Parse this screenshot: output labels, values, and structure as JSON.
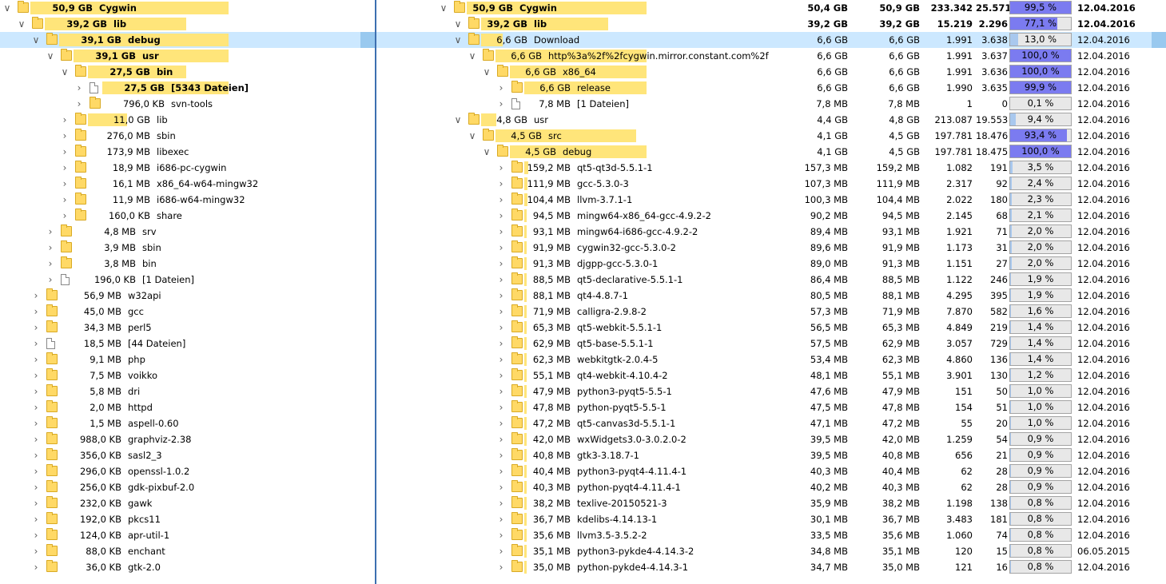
{
  "colors": {
    "bar_primary": "#ffe57a",
    "bar_secondary": "#fff0b4",
    "selection": "#cce8ff",
    "pct_fill_high": "#7b7bf0",
    "pct_fill_low": "#a9c8ee",
    "pct_bg": "#e8e8e8",
    "splitter": "#3d6fb0"
  },
  "left_tree": [
    {
      "depth": 0,
      "expander": "expanded",
      "icon": "folder",
      "size": "50,9 GB",
      "name": "Cygwin",
      "bold": true,
      "fraction": 1.0
    },
    {
      "depth": 1,
      "expander": "expanded",
      "icon": "folder",
      "size": "39,2 GB",
      "name": "lib",
      "bold": true,
      "fraction": 0.77
    },
    {
      "depth": 2,
      "expander": "expanded",
      "icon": "folder",
      "size": "39,1 GB",
      "name": "debug",
      "bold": true,
      "fraction": 1.0,
      "selected": true
    },
    {
      "depth": 3,
      "expander": "expanded",
      "icon": "folder",
      "size": "39,1 GB",
      "name": "usr",
      "bold": true,
      "fraction": 1.0
    },
    {
      "depth": 4,
      "expander": "expanded",
      "icon": "folder",
      "size": "27,5 GB",
      "name": "bin",
      "bold": true,
      "fraction": 0.7
    },
    {
      "depth": 5,
      "expander": "collapsed",
      "icon": "file",
      "size": "27,5 GB",
      "name": "[5343 Dateien]",
      "bold": true,
      "fraction": 1.0
    },
    {
      "depth": 5,
      "expander": "collapsed",
      "icon": "folder",
      "size": "796,0 KB",
      "name": "svn-tools",
      "bold": false,
      "fraction": 0.0
    },
    {
      "depth": 4,
      "expander": "collapsed",
      "icon": "folder",
      "size": "11,0 GB",
      "name": "lib",
      "bold": false,
      "fraction": 0.28
    },
    {
      "depth": 4,
      "expander": "collapsed",
      "icon": "folder",
      "size": "276,0 MB",
      "name": "sbin",
      "bold": false,
      "fraction": 0.0
    },
    {
      "depth": 4,
      "expander": "collapsed",
      "icon": "folder",
      "size": "173,9 MB",
      "name": "libexec",
      "bold": false,
      "fraction": 0.0
    },
    {
      "depth": 4,
      "expander": "collapsed",
      "icon": "folder",
      "size": "18,9 MB",
      "name": "i686-pc-cygwin",
      "bold": false,
      "fraction": 0.0
    },
    {
      "depth": 4,
      "expander": "collapsed",
      "icon": "folder",
      "size": "16,1 MB",
      "name": "x86_64-w64-mingw32",
      "bold": false,
      "fraction": 0.0
    },
    {
      "depth": 4,
      "expander": "collapsed",
      "icon": "folder",
      "size": "11,9 MB",
      "name": "i686-w64-mingw32",
      "bold": false,
      "fraction": 0.0
    },
    {
      "depth": 4,
      "expander": "collapsed",
      "icon": "folder",
      "size": "160,0 KB",
      "name": "share",
      "bold": false,
      "fraction": 0.0
    },
    {
      "depth": 3,
      "expander": "collapsed",
      "icon": "folder",
      "size": "4,8 MB",
      "name": "srv",
      "bold": false,
      "fraction": 0.0
    },
    {
      "depth": 3,
      "expander": "collapsed",
      "icon": "folder",
      "size": "3,9 MB",
      "name": "sbin",
      "bold": false,
      "fraction": 0.0
    },
    {
      "depth": 3,
      "expander": "collapsed",
      "icon": "folder",
      "size": "3,8 MB",
      "name": "bin",
      "bold": false,
      "fraction": 0.0
    },
    {
      "depth": 3,
      "expander": "collapsed",
      "icon": "file",
      "size": "196,0 KB",
      "name": "[1 Dateien]",
      "bold": false,
      "fraction": 0.0
    },
    {
      "depth": 2,
      "expander": "collapsed",
      "icon": "folder",
      "size": "56,9 MB",
      "name": "w32api",
      "bold": false,
      "fraction": 0.0
    },
    {
      "depth": 2,
      "expander": "collapsed",
      "icon": "folder",
      "size": "45,0 MB",
      "name": "gcc",
      "bold": false,
      "fraction": 0.0
    },
    {
      "depth": 2,
      "expander": "collapsed",
      "icon": "folder",
      "size": "34,3 MB",
      "name": "perl5",
      "bold": false,
      "fraction": 0.0
    },
    {
      "depth": 2,
      "expander": "collapsed",
      "icon": "file",
      "size": "18,5 MB",
      "name": "[44 Dateien]",
      "bold": false,
      "fraction": 0.0
    },
    {
      "depth": 2,
      "expander": "collapsed",
      "icon": "folder",
      "size": "9,1 MB",
      "name": "php",
      "bold": false,
      "fraction": 0.0
    },
    {
      "depth": 2,
      "expander": "collapsed",
      "icon": "folder",
      "size": "7,5 MB",
      "name": "voikko",
      "bold": false,
      "fraction": 0.0
    },
    {
      "depth": 2,
      "expander": "collapsed",
      "icon": "folder",
      "size": "5,8 MB",
      "name": "dri",
      "bold": false,
      "fraction": 0.0
    },
    {
      "depth": 2,
      "expander": "collapsed",
      "icon": "folder",
      "size": "2,0 MB",
      "name": "httpd",
      "bold": false,
      "fraction": 0.0
    },
    {
      "depth": 2,
      "expander": "collapsed",
      "icon": "folder",
      "size": "1,5 MB",
      "name": "aspell-0.60",
      "bold": false,
      "fraction": 0.0
    },
    {
      "depth": 2,
      "expander": "collapsed",
      "icon": "folder",
      "size": "988,0 KB",
      "name": "graphviz-2.38",
      "bold": false,
      "fraction": 0.0
    },
    {
      "depth": 2,
      "expander": "collapsed",
      "icon": "folder",
      "size": "356,0 KB",
      "name": "sasl2_3",
      "bold": false,
      "fraction": 0.0
    },
    {
      "depth": 2,
      "expander": "collapsed",
      "icon": "folder",
      "size": "296,0 KB",
      "name": "openssl-1.0.2",
      "bold": false,
      "fraction": 0.0
    },
    {
      "depth": 2,
      "expander": "collapsed",
      "icon": "folder",
      "size": "256,0 KB",
      "name": "gdk-pixbuf-2.0",
      "bold": false,
      "fraction": 0.0
    },
    {
      "depth": 2,
      "expander": "collapsed",
      "icon": "folder",
      "size": "232,0 KB",
      "name": "gawk",
      "bold": false,
      "fraction": 0.0
    },
    {
      "depth": 2,
      "expander": "collapsed",
      "icon": "folder",
      "size": "192,0 KB",
      "name": "pkcs11",
      "bold": false,
      "fraction": 0.0
    },
    {
      "depth": 2,
      "expander": "collapsed",
      "icon": "folder",
      "size": "124,0 KB",
      "name": "apr-util-1",
      "bold": false,
      "fraction": 0.0
    },
    {
      "depth": 2,
      "expander": "collapsed",
      "icon": "folder",
      "size": "88,0 KB",
      "name": "enchant",
      "bold": false,
      "fraction": 0.0
    },
    {
      "depth": 2,
      "expander": "collapsed",
      "icon": "folder",
      "size": "36,0 KB",
      "name": "gtk-2.0",
      "bold": false,
      "fraction": 0.0
    }
  ],
  "right_tree": [
    {
      "depth": 0,
      "expander": "expanded",
      "icon": "folder",
      "size": "50,9 GB",
      "name": "Cygwin",
      "bold": true,
      "fraction": 1.0,
      "alloc": "50,4 GB",
      "total": "50,9 GB",
      "files": "233.342",
      "folders": "25.571",
      "pct": "99,5 %",
      "pct_value": 99.5,
      "date": "12.04.2016"
    },
    {
      "depth": 1,
      "expander": "expanded",
      "icon": "folder",
      "size": "39,2 GB",
      "name": "lib",
      "bold": true,
      "fraction": 0.77,
      "alloc": "39,2 GB",
      "total": "39,2 GB",
      "files": "15.219",
      "folders": "2.296",
      "pct": "77,1 %",
      "pct_value": 77.1,
      "date": "12.04.2016"
    },
    {
      "depth": 1,
      "expander": "expanded",
      "icon": "folder",
      "size": "6,6 GB",
      "name": "Download",
      "bold": false,
      "fraction": 0.13,
      "alloc": "6,6 GB",
      "total": "6,6 GB",
      "files": "1.991",
      "folders": "3.638",
      "pct": "13,0 %",
      "pct_value": 13.0,
      "date": "12.04.2016",
      "selected": true
    },
    {
      "depth": 2,
      "expander": "expanded",
      "icon": "folder",
      "size": "6,6 GB",
      "name": "http%3a%2f%2fcygwin.mirror.constant.com%2f",
      "bold": false,
      "fraction": 1.0,
      "alloc": "6,6 GB",
      "total": "6,6 GB",
      "files": "1.991",
      "folders": "3.637",
      "pct": "100,0 %",
      "pct_value": 100.0,
      "date": "12.04.2016"
    },
    {
      "depth": 3,
      "expander": "expanded",
      "icon": "folder",
      "size": "6,6 GB",
      "name": "x86_64",
      "bold": false,
      "fraction": 1.0,
      "alloc": "6,6 GB",
      "total": "6,6 GB",
      "files": "1.991",
      "folders": "3.636",
      "pct": "100,0 %",
      "pct_value": 100.0,
      "date": "12.04.2016"
    },
    {
      "depth": 4,
      "expander": "collapsed",
      "icon": "folder",
      "size": "6,6 GB",
      "name": "release",
      "bold": false,
      "fraction": 1.0,
      "alloc": "6,6 GB",
      "total": "6,6 GB",
      "files": "1.990",
      "folders": "3.635",
      "pct": "99,9 %",
      "pct_value": 99.9,
      "date": "12.04.2016"
    },
    {
      "depth": 4,
      "expander": "collapsed",
      "icon": "file",
      "size": "7,8 MB",
      "name": "[1 Dateien]",
      "bold": false,
      "fraction": 0.0,
      "alloc": "7,8 MB",
      "total": "7,8 MB",
      "files": "1",
      "folders": "0",
      "pct": "0,1 %",
      "pct_value": 0.1,
      "date": "12.04.2016"
    },
    {
      "depth": 1,
      "expander": "expanded",
      "icon": "folder",
      "size": "4,8 GB",
      "name": "usr",
      "bold": false,
      "fraction": 0.09,
      "alloc": "4,4 GB",
      "total": "4,8 GB",
      "files": "213.087",
      "folders": "19.553",
      "pct": "9,4 %",
      "pct_value": 9.4,
      "date": "12.04.2016"
    },
    {
      "depth": 2,
      "expander": "expanded",
      "icon": "folder",
      "size": "4,5 GB",
      "name": "src",
      "bold": false,
      "fraction": 0.93,
      "alloc": "4,1 GB",
      "total": "4,5 GB",
      "files": "197.781",
      "folders": "18.476",
      "pct": "93,4 %",
      "pct_value": 93.4,
      "date": "12.04.2016"
    },
    {
      "depth": 3,
      "expander": "expanded",
      "icon": "folder",
      "size": "4,5 GB",
      "name": "debug",
      "bold": false,
      "fraction": 1.0,
      "alloc": "4,1 GB",
      "total": "4,5 GB",
      "files": "197.781",
      "folders": "18.475",
      "pct": "100,0 %",
      "pct_value": 100.0,
      "date": "12.04.2016"
    },
    {
      "depth": 4,
      "expander": "collapsed",
      "icon": "folder",
      "size": "159,2 MB",
      "name": "qt5-qt3d-5.5.1-1",
      "bold": false,
      "fraction": 0.035,
      "alloc": "157,3 MB",
      "total": "159,2 MB",
      "files": "1.082",
      "folders": "191",
      "pct": "3,5 %",
      "pct_value": 3.5,
      "date": "12.04.2016"
    },
    {
      "depth": 4,
      "expander": "collapsed",
      "icon": "folder",
      "size": "111,9 MB",
      "name": "gcc-5.3.0-3",
      "bold": false,
      "fraction": 0.024,
      "alloc": "107,3 MB",
      "total": "111,9 MB",
      "files": "2.317",
      "folders": "92",
      "pct": "2,4 %",
      "pct_value": 2.4,
      "date": "12.04.2016"
    },
    {
      "depth": 4,
      "expander": "collapsed",
      "icon": "folder",
      "size": "104,4 MB",
      "name": "llvm-3.7.1-1",
      "bold": false,
      "fraction": 0.023,
      "alloc": "100,3 MB",
      "total": "104,4 MB",
      "files": "2.022",
      "folders": "180",
      "pct": "2,3 %",
      "pct_value": 2.3,
      "date": "12.04.2016"
    },
    {
      "depth": 4,
      "expander": "collapsed",
      "icon": "folder",
      "size": "94,5 MB",
      "name": "mingw64-x86_64-gcc-4.9.2-2",
      "bold": false,
      "fraction": 0.021,
      "alloc": "90,2 MB",
      "total": "94,5 MB",
      "files": "2.145",
      "folders": "68",
      "pct": "2,1 %",
      "pct_value": 2.1,
      "date": "12.04.2016"
    },
    {
      "depth": 4,
      "expander": "collapsed",
      "icon": "folder",
      "size": "93,1 MB",
      "name": "mingw64-i686-gcc-4.9.2-2",
      "bold": false,
      "fraction": 0.02,
      "alloc": "89,4 MB",
      "total": "93,1 MB",
      "files": "1.921",
      "folders": "71",
      "pct": "2,0 %",
      "pct_value": 2.0,
      "date": "12.04.2016"
    },
    {
      "depth": 4,
      "expander": "collapsed",
      "icon": "folder",
      "size": "91,9 MB",
      "name": "cygwin32-gcc-5.3.0-2",
      "bold": false,
      "fraction": 0.02,
      "alloc": "89,6 MB",
      "total": "91,9 MB",
      "files": "1.173",
      "folders": "31",
      "pct": "2,0 %",
      "pct_value": 2.0,
      "date": "12.04.2016"
    },
    {
      "depth": 4,
      "expander": "collapsed",
      "icon": "folder",
      "size": "91,3 MB",
      "name": "djgpp-gcc-5.3.0-1",
      "bold": false,
      "fraction": 0.02,
      "alloc": "89,0 MB",
      "total": "91,3 MB",
      "files": "1.151",
      "folders": "27",
      "pct": "2,0 %",
      "pct_value": 2.0,
      "date": "12.04.2016"
    },
    {
      "depth": 4,
      "expander": "collapsed",
      "icon": "folder",
      "size": "88,5 MB",
      "name": "qt5-declarative-5.5.1-1",
      "bold": false,
      "fraction": 0.019,
      "alloc": "86,4 MB",
      "total": "88,5 MB",
      "files": "1.122",
      "folders": "246",
      "pct": "1,9 %",
      "pct_value": 1.9,
      "date": "12.04.2016"
    },
    {
      "depth": 4,
      "expander": "collapsed",
      "icon": "folder",
      "size": "88,1 MB",
      "name": "qt4-4.8.7-1",
      "bold": false,
      "fraction": 0.019,
      "alloc": "80,5 MB",
      "total": "88,1 MB",
      "files": "4.295",
      "folders": "395",
      "pct": "1,9 %",
      "pct_value": 1.9,
      "date": "12.04.2016"
    },
    {
      "depth": 4,
      "expander": "collapsed",
      "icon": "folder",
      "size": "71,9 MB",
      "name": "calligra-2.9.8-2",
      "bold": false,
      "fraction": 0.016,
      "alloc": "57,3 MB",
      "total": "71,9 MB",
      "files": "7.870",
      "folders": "582",
      "pct": "1,6 %",
      "pct_value": 1.6,
      "date": "12.04.2016"
    },
    {
      "depth": 4,
      "expander": "collapsed",
      "icon": "folder",
      "size": "65,3 MB",
      "name": "qt5-webkit-5.5.1-1",
      "bold": false,
      "fraction": 0.014,
      "alloc": "56,5 MB",
      "total": "65,3 MB",
      "files": "4.849",
      "folders": "219",
      "pct": "1,4 %",
      "pct_value": 1.4,
      "date": "12.04.2016"
    },
    {
      "depth": 4,
      "expander": "collapsed",
      "icon": "folder",
      "size": "62,9 MB",
      "name": "qt5-base-5.5.1-1",
      "bold": false,
      "fraction": 0.014,
      "alloc": "57,5 MB",
      "total": "62,9 MB",
      "files": "3.057",
      "folders": "729",
      "pct": "1,4 %",
      "pct_value": 1.4,
      "date": "12.04.2016"
    },
    {
      "depth": 4,
      "expander": "collapsed",
      "icon": "folder",
      "size": "62,3 MB",
      "name": "webkitgtk-2.0.4-5",
      "bold": false,
      "fraction": 0.014,
      "alloc": "53,4 MB",
      "total": "62,3 MB",
      "files": "4.860",
      "folders": "136",
      "pct": "1,4 %",
      "pct_value": 1.4,
      "date": "12.04.2016"
    },
    {
      "depth": 4,
      "expander": "collapsed",
      "icon": "folder",
      "size": "55,1 MB",
      "name": "qt4-webkit-4.10.4-2",
      "bold": false,
      "fraction": 0.012,
      "alloc": "48,1 MB",
      "total": "55,1 MB",
      "files": "3.901",
      "folders": "130",
      "pct": "1,2 %",
      "pct_value": 1.2,
      "date": "12.04.2016"
    },
    {
      "depth": 4,
      "expander": "collapsed",
      "icon": "folder",
      "size": "47,9 MB",
      "name": "python3-pyqt5-5.5-1",
      "bold": false,
      "fraction": 0.01,
      "alloc": "47,6 MB",
      "total": "47,9 MB",
      "files": "151",
      "folders": "50",
      "pct": "1,0 %",
      "pct_value": 1.0,
      "date": "12.04.2016"
    },
    {
      "depth": 4,
      "expander": "collapsed",
      "icon": "folder",
      "size": "47,8 MB",
      "name": "python-pyqt5-5.5-1",
      "bold": false,
      "fraction": 0.01,
      "alloc": "47,5 MB",
      "total": "47,8 MB",
      "files": "154",
      "folders": "51",
      "pct": "1,0 %",
      "pct_value": 1.0,
      "date": "12.04.2016"
    },
    {
      "depth": 4,
      "expander": "collapsed",
      "icon": "folder",
      "size": "47,2 MB",
      "name": "qt5-canvas3d-5.5.1-1",
      "bold": false,
      "fraction": 0.01,
      "alloc": "47,1 MB",
      "total": "47,2 MB",
      "files": "55",
      "folders": "20",
      "pct": "1,0 %",
      "pct_value": 1.0,
      "date": "12.04.2016"
    },
    {
      "depth": 4,
      "expander": "collapsed",
      "icon": "folder",
      "size": "42,0 MB",
      "name": "wxWidgets3.0-3.0.2.0-2",
      "bold": false,
      "fraction": 0.009,
      "alloc": "39,5 MB",
      "total": "42,0 MB",
      "files": "1.259",
      "folders": "54",
      "pct": "0,9 %",
      "pct_value": 0.9,
      "date": "12.04.2016"
    },
    {
      "depth": 4,
      "expander": "collapsed",
      "icon": "folder",
      "size": "40,8 MB",
      "name": "gtk3-3.18.7-1",
      "bold": false,
      "fraction": 0.009,
      "alloc": "39,5 MB",
      "total": "40,8 MB",
      "files": "656",
      "folders": "21",
      "pct": "0,9 %",
      "pct_value": 0.9,
      "date": "12.04.2016"
    },
    {
      "depth": 4,
      "expander": "collapsed",
      "icon": "folder",
      "size": "40,4 MB",
      "name": "python3-pyqt4-4.11.4-1",
      "bold": false,
      "fraction": 0.009,
      "alloc": "40,3 MB",
      "total": "40,4 MB",
      "files": "62",
      "folders": "28",
      "pct": "0,9 %",
      "pct_value": 0.9,
      "date": "12.04.2016"
    },
    {
      "depth": 4,
      "expander": "collapsed",
      "icon": "folder",
      "size": "40,3 MB",
      "name": "python-pyqt4-4.11.4-1",
      "bold": false,
      "fraction": 0.009,
      "alloc": "40,2 MB",
      "total": "40,3 MB",
      "files": "62",
      "folders": "28",
      "pct": "0,9 %",
      "pct_value": 0.9,
      "date": "12.04.2016"
    },
    {
      "depth": 4,
      "expander": "collapsed",
      "icon": "folder",
      "size": "38,2 MB",
      "name": "texlive-20150521-3",
      "bold": false,
      "fraction": 0.008,
      "alloc": "35,9 MB",
      "total": "38,2 MB",
      "files": "1.198",
      "folders": "138",
      "pct": "0,8 %",
      "pct_value": 0.8,
      "date": "12.04.2016"
    },
    {
      "depth": 4,
      "expander": "collapsed",
      "icon": "folder",
      "size": "36,7 MB",
      "name": "kdelibs-4.14.13-1",
      "bold": false,
      "fraction": 0.008,
      "alloc": "30,1 MB",
      "total": "36,7 MB",
      "files": "3.483",
      "folders": "181",
      "pct": "0,8 %",
      "pct_value": 0.8,
      "date": "12.04.2016"
    },
    {
      "depth": 4,
      "expander": "collapsed",
      "icon": "folder",
      "size": "35,6 MB",
      "name": "llvm3.5-3.5.2-2",
      "bold": false,
      "fraction": 0.008,
      "alloc": "33,5 MB",
      "total": "35,6 MB",
      "files": "1.060",
      "folders": "74",
      "pct": "0,8 %",
      "pct_value": 0.8,
      "date": "12.04.2016"
    },
    {
      "depth": 4,
      "expander": "collapsed",
      "icon": "folder",
      "size": "35,1 MB",
      "name": "python3-pykde4-4.14.3-2",
      "bold": false,
      "fraction": 0.008,
      "alloc": "34,8 MB",
      "total": "35,1 MB",
      "files": "120",
      "folders": "15",
      "pct": "0,8 %",
      "pct_value": 0.8,
      "date": "06.05.2015"
    },
    {
      "depth": 4,
      "expander": "collapsed",
      "icon": "folder",
      "size": "35,0 MB",
      "name": "python-pykde4-4.14.3-1",
      "bold": false,
      "fraction": 0.008,
      "alloc": "34,7 MB",
      "total": "35,0 MB",
      "files": "121",
      "folders": "16",
      "pct": "0,8 %",
      "pct_value": 0.8,
      "date": "12.04.2016"
    }
  ]
}
